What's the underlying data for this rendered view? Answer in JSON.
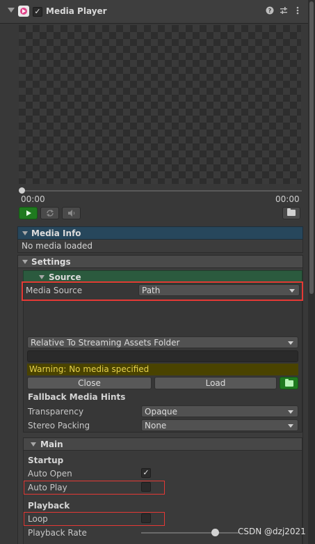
{
  "component": {
    "title": "Media Player",
    "enabled_mark": "✓",
    "header_icons": [
      "help-icon",
      "presets-icon",
      "kebab-menu-icon"
    ]
  },
  "playback_bar": {
    "time_current": "00:00",
    "time_total": "00:00",
    "progress": 0
  },
  "media_info": {
    "title": "Media Info",
    "status": "No media loaded"
  },
  "settings": {
    "title": "Settings",
    "source": {
      "title": "Source",
      "media_source_label": "Media Source",
      "media_source_value": "Path",
      "path_type_value": "Relative To Streaming Assets Folder",
      "path_value": "",
      "warning": "Warning: No media specified",
      "close_label": "Close",
      "load_label": "Load",
      "fallback_title": "Fallback Media Hints",
      "transparency_label": "Transparency",
      "transparency_value": "Opaque",
      "stereo_label": "Stereo Packing",
      "stereo_value": "None"
    },
    "main": {
      "title": "Main",
      "startup_title": "Startup",
      "auto_open_label": "Auto Open",
      "auto_open_checked": true,
      "auto_play_label": "Auto Play",
      "auto_play_checked": false,
      "playback_title": "Playback",
      "loop_label": "Loop",
      "loop_checked": false,
      "rate_label": "Playback Rate"
    }
  },
  "watermark": "CSDN @dzj2021",
  "colors": {
    "highlight": "#e53935",
    "play_green": "#1f7a1f",
    "media_info_header": "#27475c",
    "source_header": "#2b5a3e",
    "warning_bg": "#4a4300",
    "warning_text": "#e6d24a"
  }
}
